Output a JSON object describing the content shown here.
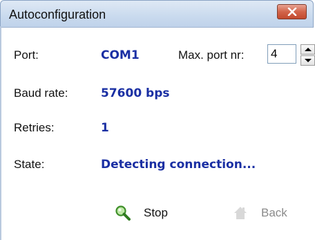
{
  "window": {
    "title": "Autoconfiguration"
  },
  "port": {
    "label": "Port:",
    "value": "COM1"
  },
  "max_port": {
    "label": "Max. port nr:",
    "value": "4"
  },
  "baud": {
    "label": "Baud rate:",
    "value": "57600 bps"
  },
  "retries": {
    "label": "Retries:",
    "value": "1"
  },
  "state": {
    "label": "State:",
    "value": "Detecting connection..."
  },
  "buttons": {
    "stop": {
      "label": "Stop",
      "icon": "search-icon",
      "enabled": true
    },
    "back": {
      "label": "Back",
      "icon": "home-icon",
      "enabled": false
    }
  },
  "colors": {
    "value_text": "#1a2fa3",
    "close_button": "#d2644a",
    "disabled_text": "#8a8a8a"
  }
}
